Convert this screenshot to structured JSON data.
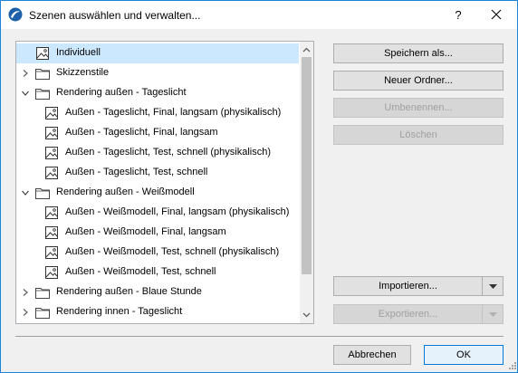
{
  "window": {
    "title": "Szenen auswählen und verwalten...",
    "help_label": "?"
  },
  "tree": {
    "items": [
      {
        "label": "Individuell",
        "kind": "scene",
        "level": 0,
        "selected": true
      },
      {
        "label": "Skizzenstile",
        "kind": "folder",
        "level": 0,
        "expanded": false
      },
      {
        "label": "Rendering außen - Tageslicht",
        "kind": "folder",
        "level": 0,
        "expanded": true
      },
      {
        "label": "Außen - Tageslicht, Final, langsam (physikalisch)",
        "kind": "scene",
        "level": 1
      },
      {
        "label": "Außen - Tageslicht, Final, langsam",
        "kind": "scene",
        "level": 1
      },
      {
        "label": "Außen - Tageslicht, Test, schnell (physikalisch)",
        "kind": "scene",
        "level": 1
      },
      {
        "label": "Außen - Tageslicht, Test, schnell",
        "kind": "scene",
        "level": 1
      },
      {
        "label": "Rendering außen - Weißmodell",
        "kind": "folder",
        "level": 0,
        "expanded": true
      },
      {
        "label": "Außen - Weißmodell, Final, langsam (physikalisch)",
        "kind": "scene",
        "level": 1
      },
      {
        "label": "Außen - Weißmodell, Final, langsam",
        "kind": "scene",
        "level": 1
      },
      {
        "label": "Außen - Weißmodell, Test, schnell (physikalisch)",
        "kind": "scene",
        "level": 1
      },
      {
        "label": "Außen - Weißmodell, Test, schnell",
        "kind": "scene",
        "level": 1
      },
      {
        "label": "Rendering außen - Blaue Stunde",
        "kind": "folder",
        "level": 0,
        "expanded": false
      },
      {
        "label": "Rendering innen - Tageslicht",
        "kind": "folder",
        "level": 0,
        "expanded": false
      }
    ]
  },
  "actions": {
    "save_as": "Speichern als...",
    "new_folder": "Neuer Ordner...",
    "rename": "Umbenennen...",
    "delete": "Löschen",
    "import": "Importieren...",
    "export": "Exportieren..."
  },
  "footer": {
    "cancel": "Abbrechen",
    "ok": "OK"
  },
  "colors": {
    "selection": "#cce8ff",
    "accent": "#0078d7",
    "window_border": "#1883d7"
  }
}
